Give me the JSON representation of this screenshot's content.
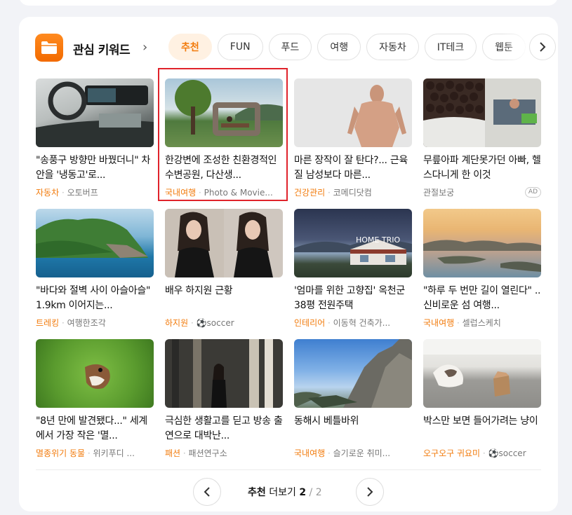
{
  "header": {
    "title": "관심 키워드",
    "chevron": "›"
  },
  "tabs": [
    {
      "label": "추천",
      "active": true
    },
    {
      "label": "FUN"
    },
    {
      "label": "푸드"
    },
    {
      "label": "여행"
    },
    {
      "label": "자동차"
    },
    {
      "label": "IT테크"
    },
    {
      "label": "웹툰"
    }
  ],
  "items": [
    {
      "title": "\"송풍구 방향만 바꿨더니\" 차 안을 '냉동고'로...",
      "category": "자동차",
      "source": "오토버프"
    },
    {
      "title": "한강변에 조성한 친환경적인 수변공원, 다산생...",
      "category": "국내여행",
      "source": "Photo & Movie..."
    },
    {
      "title": "마른 장작이 잘 탄다?... 근육질 남성보다 마른...",
      "category": "건강관리",
      "source": "코메디닷컴"
    },
    {
      "title": "무릎아파 계단못가던 아빠, 헬스다니게 한 이것",
      "category": "",
      "source": "관절보궁",
      "ad": "AD"
    },
    {
      "title": "\"바다와 절벽 사이 아슬아슬\" 1.9km 이어지는...",
      "category": "트레킹",
      "source": "여행한조각"
    },
    {
      "title": "배우 하지원 근황",
      "category": "하지원",
      "source": "soccer"
    },
    {
      "title": "'엄마를 위한 고향집' 옥천군 38평 전원주택",
      "category": "인테리어",
      "source": "이동혁 건축가..."
    },
    {
      "title": "\"하루 두 번만 길이 열린다\" .. 신비로운 섬 여행...",
      "category": "국내여행",
      "source": "셀럽스케치"
    },
    {
      "title": "\"8년 만에 발견됐다...\" 세계에서 가장 작은 '멸...",
      "category": "멸종위기 동물",
      "source": "위키푸디 ..."
    },
    {
      "title": "극심한 생활고를 딛고 방송 출연으로 대박난...",
      "category": "패션",
      "source": "패션연구소"
    },
    {
      "title": "동해시 베틀바위",
      "category": "국내여행",
      "source": "슬기로운 취미..."
    },
    {
      "title": "박스만 보면 들어가려는 냥이",
      "category": "오구오구 귀요미",
      "source": "soccer"
    }
  ],
  "thumb_watermark": "HOME TRIO",
  "pager": {
    "label": "추천",
    "more": "더보기",
    "current": "2",
    "separator": "/",
    "total": "2"
  },
  "colors": {
    "accent": "#f27b0c",
    "highlight": "#e0232b"
  }
}
